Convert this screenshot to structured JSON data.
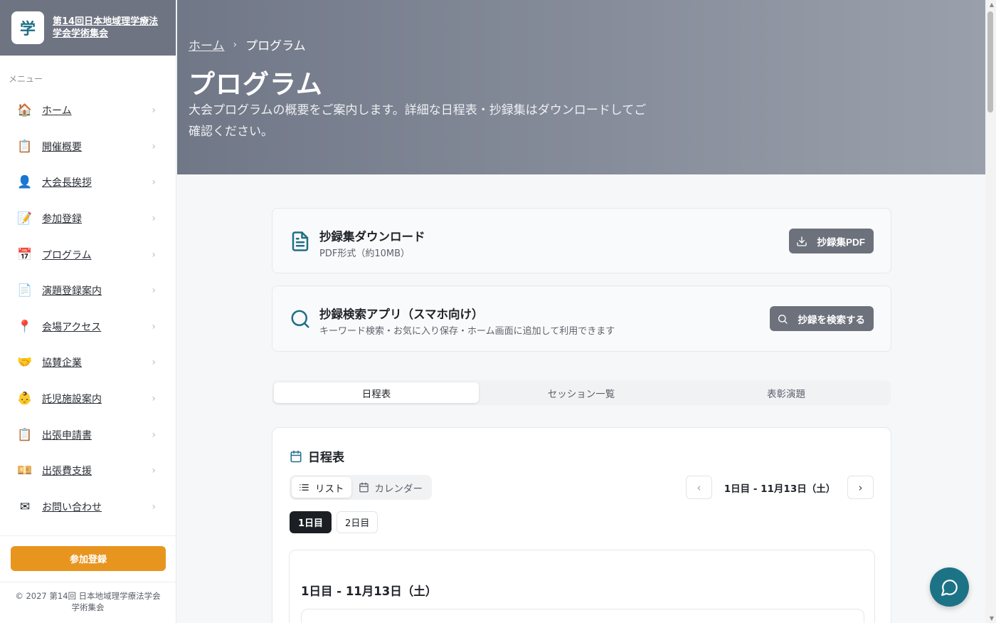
{
  "brand": {
    "logo_char": "学",
    "title_line1": "第14回日本地域理学療法",
    "title_line2": "学会学術集会"
  },
  "sidebar": {
    "menu_label": "メニュー",
    "items": [
      {
        "label": "ホーム",
        "icon": "🏠",
        "icon_name": "house-icon"
      },
      {
        "label": "開催概要",
        "icon": "📋",
        "icon_name": "clipboard-icon"
      },
      {
        "label": "大会長挨拶",
        "icon": "👤",
        "icon_name": "person-icon"
      },
      {
        "label": "参加登録",
        "icon": "📝",
        "icon_name": "memo-icon"
      },
      {
        "label": "プログラム",
        "icon": "📅",
        "icon_name": "calendar-icon"
      },
      {
        "label": "演題登録案内",
        "icon": "📄",
        "icon_name": "document-icon"
      },
      {
        "label": "会場アクセス",
        "icon": "📍",
        "icon_name": "pin-icon"
      },
      {
        "label": "協賛企業",
        "icon": "🤝",
        "icon_name": "handshake-icon"
      },
      {
        "label": "託児施設案内",
        "icon": "👶",
        "icon_name": "baby-icon"
      },
      {
        "label": "出張申請書",
        "icon": "📋",
        "icon_name": "clipboard-icon"
      },
      {
        "label": "出張費支援",
        "icon": "💴",
        "icon_name": "money-icon"
      },
      {
        "label": "お問い合わせ",
        "icon": "✉",
        "icon_name": "envelope-icon"
      }
    ],
    "chevron": "›",
    "cta_label": "参加登録",
    "footer_text": "© 2027 第14回 日本地域理学療法学会学術集会"
  },
  "hero": {
    "breadcrumb_home": "ホーム",
    "breadcrumb_sep": "›",
    "breadcrumb_current": "プログラム",
    "title": "プログラム",
    "description": "大会プログラムの概要をご案内します。詳細な日程表・抄録集はダウンロードしてご確認ください。"
  },
  "download_card": {
    "title": "抄録集ダウンロード",
    "subtitle": "PDF形式（約10MB）",
    "button_label": "抄録集PDF"
  },
  "search_card": {
    "title": "抄録検索アプリ（スマホ向け）",
    "subtitle": "キーワード検索・お気に入り保存・ホーム画面に追加して利用できます",
    "button_label": "抄録を検索する"
  },
  "tabs": [
    {
      "label": "日程表",
      "active": true
    },
    {
      "label": "セッション一覧",
      "active": false
    },
    {
      "label": "表彰演題",
      "active": false
    }
  ],
  "schedule": {
    "title": "日程表",
    "view_list": "リスト",
    "view_calendar": "カレンダー",
    "current_day": "1日目 - 11月13日（土）",
    "prev": "‹",
    "next": "›",
    "day_tabs": [
      "1日目",
      "2日目"
    ],
    "day_heading": "1日目 - 11月13日（土）"
  },
  "colors": {
    "accent_teal": "#1e6f86",
    "cta_orange": "#e8951f",
    "button_gray": "#6c717c"
  }
}
